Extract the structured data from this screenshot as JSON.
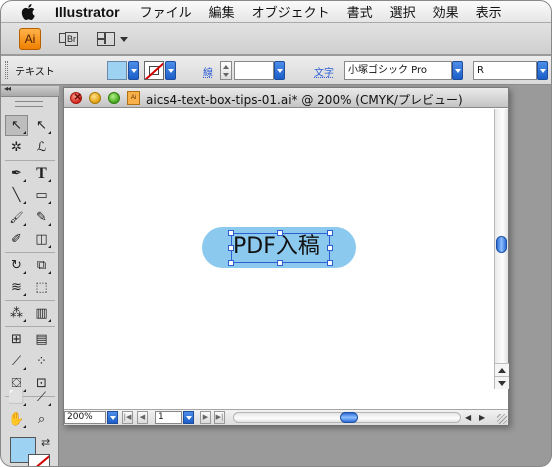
{
  "menubar": {
    "app_name": "Illustrator",
    "items": [
      "ファイル",
      "編集",
      "オブジェクト",
      "書式",
      "選択",
      "効果",
      "表示"
    ]
  },
  "app_toolbar": {
    "ai_label": "Ai",
    "bridge_label": "Br"
  },
  "control_bar": {
    "mode_label": "テキスト",
    "fill_color": "#9dd2f3",
    "stroke_link": "線",
    "stroke_weight": "",
    "text_link": "文字",
    "font_name": "小塚ゴシック Pro",
    "font_style": "R"
  },
  "tools": {
    "panel_toggle": "◂◂",
    "fill_color": "#9dd2f3",
    "items": [
      {
        "name": "selection-tool",
        "glyph": "↖",
        "selected": true
      },
      {
        "name": "direct-selection-tool",
        "glyph": "↖"
      },
      {
        "name": "magic-wand-tool",
        "glyph": "✲"
      },
      {
        "name": "lasso-tool",
        "glyph": "ℒ"
      },
      {
        "name": "pen-tool",
        "glyph": "✒"
      },
      {
        "name": "type-tool",
        "glyph": "T"
      },
      {
        "name": "line-segment-tool",
        "glyph": "╲"
      },
      {
        "name": "rectangle-tool",
        "glyph": "▭"
      },
      {
        "name": "paintbrush-tool",
        "glyph": "🖌"
      },
      {
        "name": "pencil-tool",
        "glyph": "✎"
      },
      {
        "name": "blob-brush-tool",
        "glyph": "✐"
      },
      {
        "name": "eraser-tool",
        "glyph": "◫"
      },
      {
        "name": "rotate-tool",
        "glyph": "↻"
      },
      {
        "name": "scale-tool",
        "glyph": "⧉"
      },
      {
        "name": "warp-tool",
        "glyph": "≋"
      },
      {
        "name": "free-transform-tool",
        "glyph": "⬚"
      },
      {
        "name": "symbol-sprayer-tool",
        "glyph": "⁂"
      },
      {
        "name": "column-graph-tool",
        "glyph": "▥"
      },
      {
        "name": "mesh-tool",
        "glyph": "⊞"
      },
      {
        "name": "gradient-tool",
        "glyph": "▤"
      },
      {
        "name": "eyedropper-tool",
        "glyph": "⟋"
      },
      {
        "name": "blend-tool",
        "glyph": "⁘"
      },
      {
        "name": "live-paint-bucket-tool",
        "glyph": "⛋"
      },
      {
        "name": "live-paint-selection-tool",
        "glyph": "⊡"
      },
      {
        "name": "artboard-tool",
        "glyph": "⬜"
      },
      {
        "name": "slice-tool",
        "glyph": "⟋"
      },
      {
        "name": "hand-tool",
        "glyph": "✋"
      },
      {
        "name": "zoom-tool",
        "glyph": "⌕"
      }
    ]
  },
  "document": {
    "title": "aics4-text-box-tips-01.ai* @ 200% (CMYK/プレビュー)",
    "doc_icon_label": "Ai",
    "text_content": "PDF入稿",
    "shape_color": "#8cc9ee"
  },
  "statusbar": {
    "zoom": "200%",
    "page": "1"
  }
}
